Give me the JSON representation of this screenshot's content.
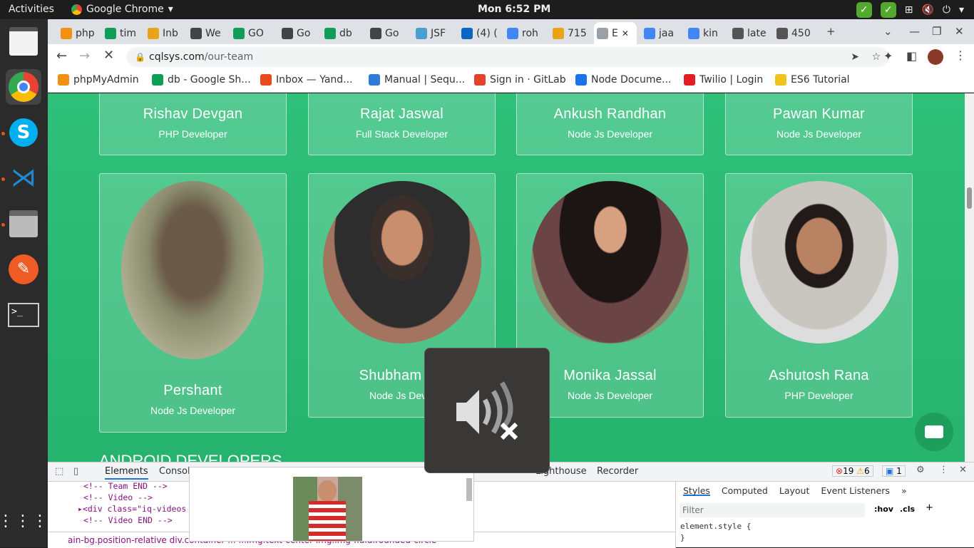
{
  "topbar": {
    "activities": "Activities",
    "app_name": "Google Chrome",
    "clock": "Mon  6:52 PM"
  },
  "tabs": [
    {
      "label": "php",
      "color": "#f29111"
    },
    {
      "label": "tim",
      "color": "#0f9d58"
    },
    {
      "label": "Inb",
      "color": "#e8a317"
    },
    {
      "label": "We",
      "color": "#444"
    },
    {
      "label": "GO",
      "color": "#0f9d58"
    },
    {
      "label": "Go",
      "color": "#444"
    },
    {
      "label": "db",
      "color": "#0f9d58"
    },
    {
      "label": "Go",
      "color": "#444"
    },
    {
      "label": "JSF",
      "color": "#4b9fd5"
    },
    {
      "label": "(4) (",
      "color": "#0a66c2"
    },
    {
      "label": "roh",
      "color": "#4285f4"
    },
    {
      "label": "715",
      "color": "#e8a317"
    },
    {
      "label": "E",
      "color": "#9aa0a6"
    },
    {
      "label": "jaa",
      "color": "#4285f4"
    },
    {
      "label": "kin",
      "color": "#4285f4"
    },
    {
      "label": "late",
      "color": "#555"
    },
    {
      "label": "450",
      "color": "#555"
    }
  ],
  "address": {
    "url_host": "cqlsys.com",
    "url_path": "/our-team"
  },
  "bookmarks": [
    {
      "label": "phpMyAdmin",
      "color": "#f29111"
    },
    {
      "label": "db - Google Sh...",
      "color": "#0f9d58"
    },
    {
      "label": "Inbox — Yand...",
      "color": "#e84a1b"
    },
    {
      "label": "Manual | Sequ...",
      "color": "#2f7bd9"
    },
    {
      "label": "Sign in · GitLab",
      "color": "#e24329"
    },
    {
      "label": "Node Docume...",
      "color": "#1a73e8"
    },
    {
      "label": "Twilio | Login",
      "color": "#e31e26"
    },
    {
      "label": "ES6 Tutorial",
      "color": "#f0c419"
    }
  ],
  "team_top": [
    {
      "name": "Rishav Devgan",
      "role": "PHP Developer"
    },
    {
      "name": "Rajat Jaswal",
      "role": "Full Stack Developer"
    },
    {
      "name": "Ankush Randhan",
      "role": "Node Js Developer"
    },
    {
      "name": "Pawan Kumar",
      "role": "Node Js Developer"
    }
  ],
  "team_bottom": [
    {
      "name": "Pershant",
      "role": "Node Js Developer"
    },
    {
      "name": "Shubham Ch",
      "role": "Node Js Devel"
    },
    {
      "name": "Monika Jassal",
      "role": "Node Js Developer"
    },
    {
      "name": "Ashutosh Rana",
      "role": "PHP Developer"
    }
  ],
  "section_title": "ANDROID DEVELOPERS",
  "devtools": {
    "tabs": [
      "Elements",
      "Console",
      "Lighthouse",
      "Recorder"
    ],
    "errors": "19",
    "warnings": "6",
    "issues": "1",
    "code_lines": [
      "<!-- Team END -->",
      "<!-- Video -->",
      "<div class=\"iq-videos",
      "<!-- Video END -->"
    ],
    "breadcrumbs": "ain-bg.position-relative   div.container   ...   ...img.text-center   img.img-fluid.rounded-circle",
    "styles_tabs": [
      "Styles",
      "Computed",
      "Layout",
      "Event Listeners"
    ],
    "filter_placeholder": "Filter",
    "hov": ":hov",
    "cls": ".cls",
    "element_style": "element.style {",
    "close_brace": "}"
  },
  "colors": {
    "page_green": "#2fc07a",
    "chat_green": "#1e9e5a"
  }
}
